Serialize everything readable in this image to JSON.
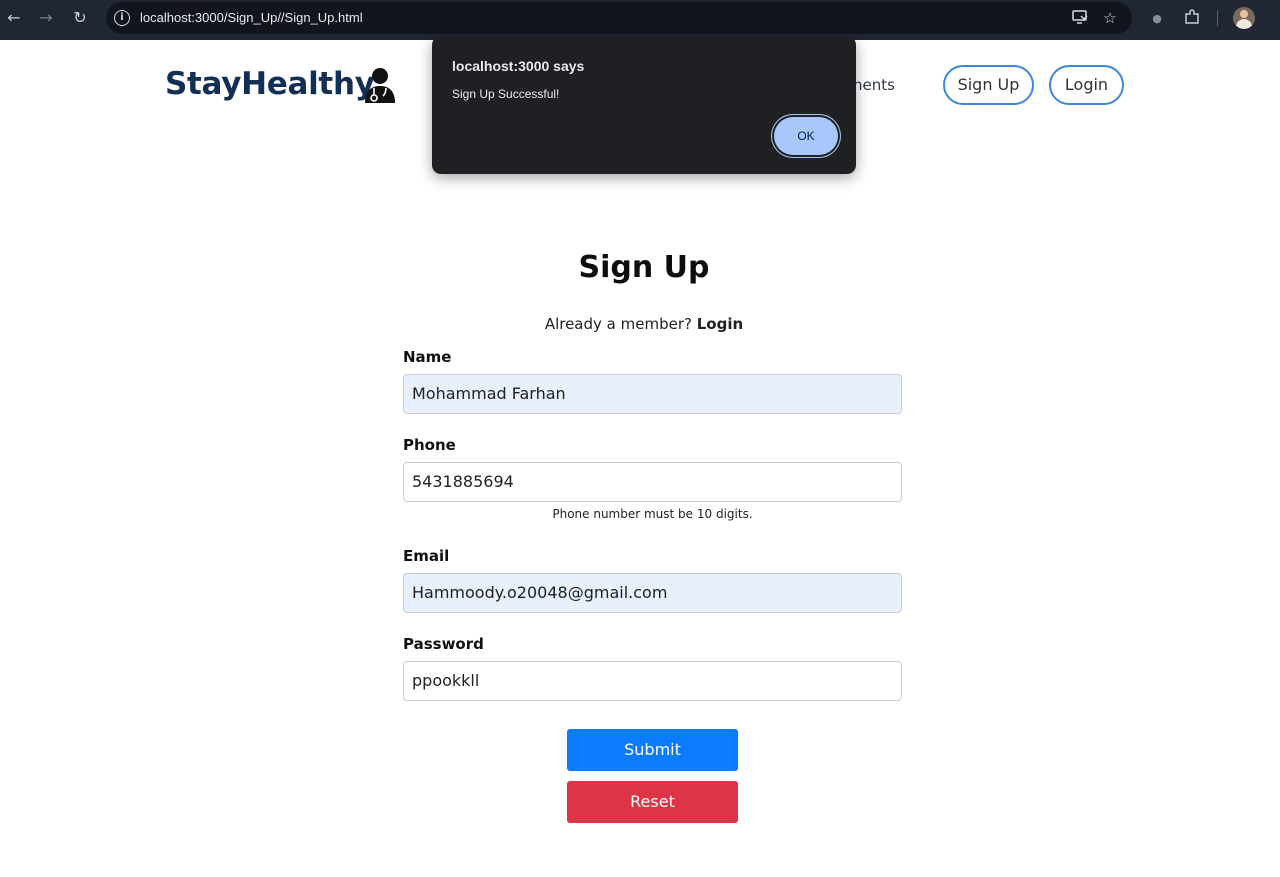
{
  "browser": {
    "url": "localhost:3000/Sign_Up//Sign_Up.html",
    "icons": {
      "back": "arrow-left-icon",
      "forward": "arrow-right-icon",
      "reload": "reload-icon",
      "site_info": "info-icon",
      "install": "install-app-icon",
      "bookmark": "star-icon",
      "extension_a": "extension-icon",
      "extensions": "puzzle-icon",
      "profile": "avatar"
    }
  },
  "header": {
    "brand": "StayHealthy",
    "nav_link": "tments",
    "signup_label": "Sign Up",
    "login_label": "Login",
    "brand_color": "#123055",
    "accent_color": "#3d86dd"
  },
  "form": {
    "title": "Sign Up",
    "member_text": "Already a member?",
    "member_link": "Login",
    "fields": {
      "name": {
        "label": "Name",
        "value": "Mohammad Farhan"
      },
      "phone": {
        "label": "Phone",
        "value": "5431885694",
        "hint": "Phone number must be 10 digits."
      },
      "email": {
        "label": "Email",
        "value": "Hammoody.o20048@gmail.com"
      },
      "password": {
        "label": "Password",
        "value": "ppookkll"
      }
    },
    "submit_label": "Submit",
    "reset_label": "Reset",
    "submit_color": "#0b7bff",
    "reset_color": "#dc3545"
  },
  "alert": {
    "title": "localhost:3000 says",
    "message": "Sign Up Successful!",
    "ok_label": "OK"
  }
}
